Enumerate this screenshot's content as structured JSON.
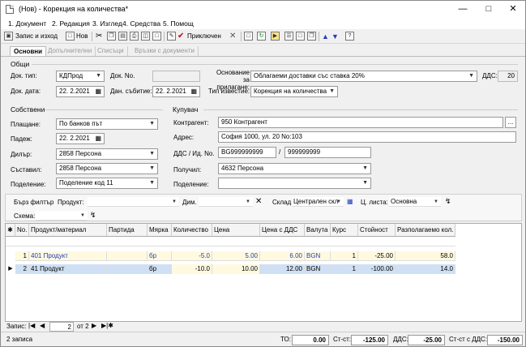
{
  "window": {
    "title": "(Нов) - Корекция на количества*"
  },
  "menu": [
    "1. Документ",
    "2. Редакция",
    "3. Изглед",
    "4. Средства",
    "5. Помощ"
  ],
  "toolbar": {
    "save_exit": "Запис и изход",
    "new": "Нов",
    "post": "Приключен"
  },
  "tabs": [
    "Основни",
    "Допълнителни",
    "Списъци",
    "Връзки с документи"
  ],
  "general": {
    "title": "Общи",
    "doc_type_label": "Док. тип:",
    "doc_type": "КДПрод",
    "doc_no_label": "Док. No.",
    "doc_no": "",
    "doc_date_label": "Док. дата:",
    "doc_date": "22. 2.2021",
    "tax_date_label": "Дан. събитие:",
    "tax_date": "22. 2.2021",
    "basis_label": "Основание за прилагане:",
    "basis": "Облагаеми доставки със ставка 20%",
    "vat_label": "ДДС:",
    "vat": "20",
    "notice_label": "Тип известие:",
    "notice": "Корекция на количества"
  },
  "own": {
    "title": "Собствени",
    "payment_label": "Плащане:",
    "payment": "По банков път",
    "due_label": "Падеж:",
    "due": "22. 2.2021",
    "dealer_label": "Дилър:",
    "dealer": "2858 Персона",
    "author_label": "Съставил:",
    "author": "2858 Персона",
    "division_label": "Поделение:",
    "division": "Поделение код 11"
  },
  "buyer": {
    "title": "Купувач",
    "contractor_label": "Контрагент:",
    "contractor": "950 Контрагент",
    "address_label": "Адрес:",
    "address": "София 1000, ул. 20 No:103",
    "vatid_label": "ДДС / Ид. No.",
    "vat_no": "BG999999999",
    "id_no": "999999999",
    "receiver_label": "Получил:",
    "receiver": "4632 Персона",
    "division_label": "Поделение:",
    "division": ""
  },
  "filter": {
    "quick_label": "Бърз филтър",
    "product_label": "Продукт:",
    "product": "",
    "dim_label": "Дим.",
    "dim": "",
    "store_label": "Склад:",
    "store": "Централен скл",
    "price_list_label": "Ц. листа:",
    "price_list": "Основна",
    "scheme_label": "Схема:",
    "scheme": ""
  },
  "grid": {
    "columns": [
      "No.",
      "Продукт/материал",
      "Партида",
      "Мярка",
      "Количество",
      "Цена",
      "Цена с ДДС",
      "Валута",
      "Курс",
      "Стойност",
      "Разполагаемо кол."
    ],
    "rows": [
      {
        "no": "1",
        "product": "401 Продукт",
        "batch": "",
        "unit": "бр",
        "qty": "-5.0",
        "price": "5.00",
        "price_vat": "6.00",
        "currency": "BGN",
        "rate": "1",
        "value": "-25.00",
        "avail": "58.0"
      },
      {
        "no": "2",
        "product": "41 Продукт",
        "batch": "",
        "unit": "бр",
        "qty": "-10.0",
        "price": "10.00",
        "price_vat": "12.00",
        "currency": "BGN",
        "rate": "1",
        "value": "-100.00",
        "avail": "14.0"
      }
    ]
  },
  "nav": {
    "label": "Запис:",
    "current": "2",
    "of_label": "от 2"
  },
  "status": {
    "count": "2 записа",
    "to_label": "ТО:",
    "to": "0.00",
    "st_label": "Ст-ст:",
    "st": "-125.00",
    "vat_label": "ДДС:",
    "vat": "-25.00",
    "stvat_label": "Ст-ст с ДДС:",
    "stvat": "-150.00"
  }
}
